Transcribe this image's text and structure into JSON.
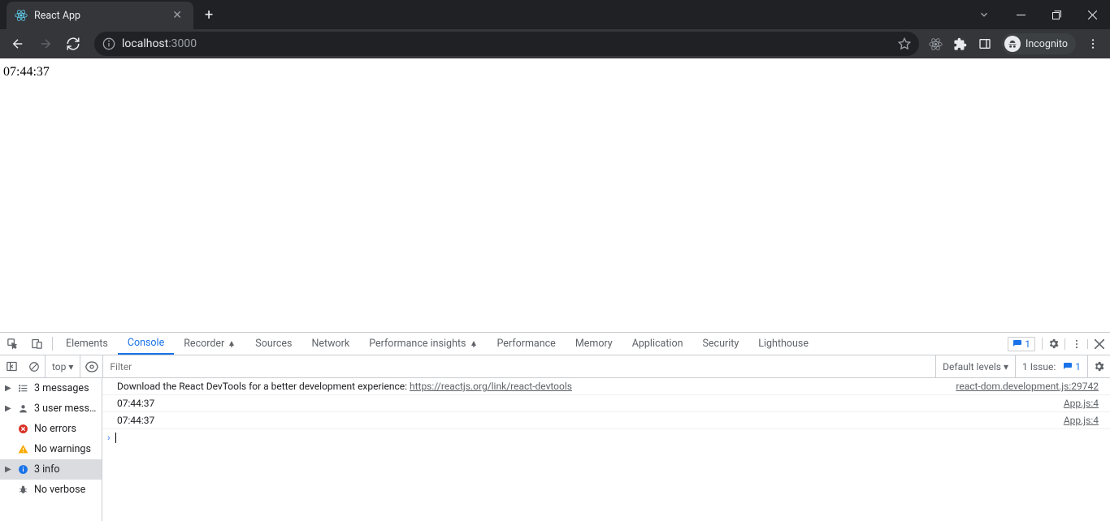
{
  "tab": {
    "title": "React App"
  },
  "url": {
    "host": "localhost",
    "port": ":3000"
  },
  "incognito": {
    "label": "Incognito"
  },
  "page": {
    "content": "07:44:37"
  },
  "devtools": {
    "tabs": [
      "Elements",
      "Console",
      "Recorder",
      "Sources",
      "Network",
      "Performance insights",
      "Performance",
      "Memory",
      "Application",
      "Security",
      "Lighthouse"
    ],
    "active_tab": "Console",
    "errors_badge": "1",
    "context": "top",
    "filter_placeholder": "Filter",
    "levels": "Default levels",
    "issues_label": "1 Issue:",
    "issues_count": "1",
    "sidebar": {
      "messages": "3 messages",
      "user": "3 user mess...",
      "errors": "No errors",
      "warnings": "No warnings",
      "info": "3 info",
      "verbose": "No verbose"
    },
    "console": {
      "row0_text": "Download the React DevTools for a better development experience: ",
      "row0_link": "https://reactjs.org/link/react-devtools",
      "row0_src": "react-dom.development.js:29742",
      "row1_text": "07:44:37",
      "row1_src": "App.js:4",
      "row2_text": "07:44:37",
      "row2_src": "App.js:4"
    }
  }
}
